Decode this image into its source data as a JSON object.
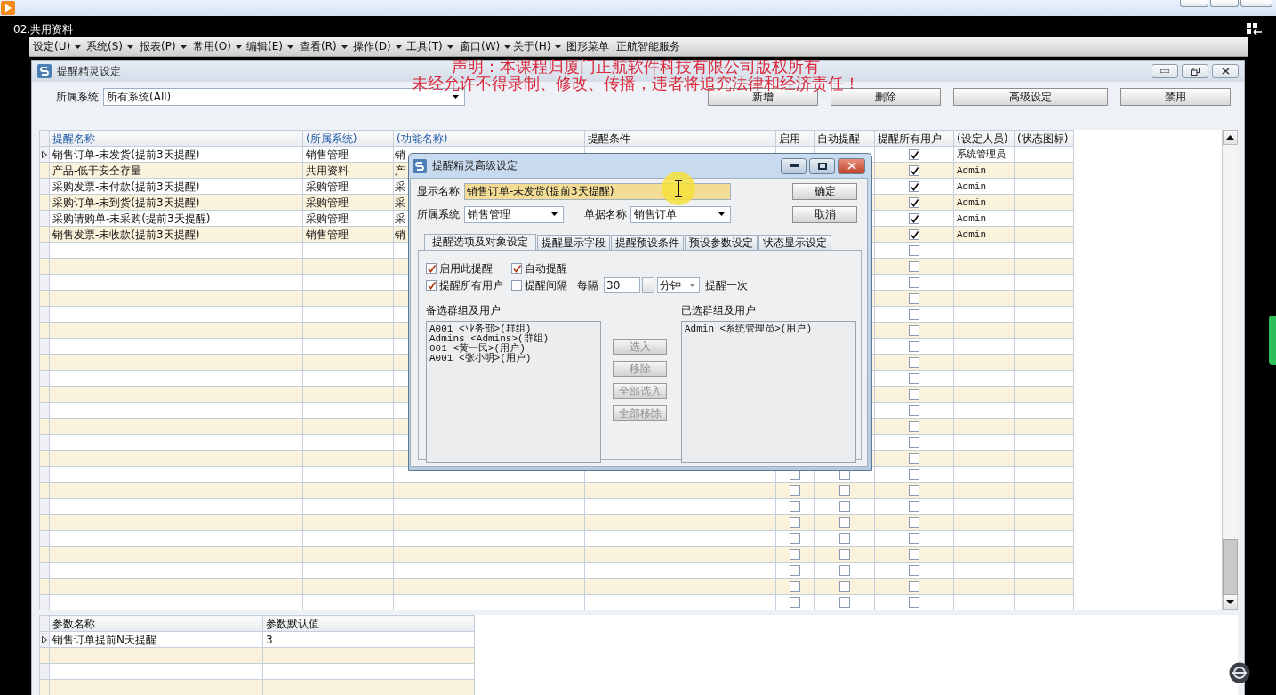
{
  "player": {
    "title": "02.共用资料"
  },
  "menu": [
    {
      "label": "设定(U)",
      "dropdown": true
    },
    {
      "label": "系统(S)",
      "dropdown": true
    },
    {
      "label": "报表(P)",
      "dropdown": true
    },
    {
      "label": "常用(O)",
      "dropdown": true
    },
    {
      "label": "编辑(E)",
      "dropdown": true
    },
    {
      "label": "查看(R)",
      "dropdown": true
    },
    {
      "label": "操作(D)",
      "dropdown": true
    },
    {
      "label": "工具(T)",
      "dropdown": true
    },
    {
      "label": "窗口(W)",
      "dropdown": true
    },
    {
      "label": "关于(H)",
      "dropdown": true
    },
    {
      "label": "图形菜单",
      "dropdown": false
    },
    {
      "label": "正航智能服务",
      "dropdown": false
    }
  ],
  "notice": [
    "声明：本课程归厦门正航软件科技有限公司版权所有",
    "未经允许不得录制、修改、传播，违者将追究法律和经济责任！"
  ],
  "window": {
    "title": "提醒精灵设定"
  },
  "filter": {
    "label": "所属系统",
    "value": "所有系统(All)"
  },
  "toolbar": [
    "新增",
    "删除",
    "高级设定",
    "禁用"
  ],
  "grid": {
    "columns": [
      {
        "label": "提醒名称",
        "highlighted": true
      },
      {
        "label": "(所属系统)",
        "highlighted": true
      },
      {
        "label": "(功能名称)",
        "highlighted": true
      },
      {
        "label": "提醒条件",
        "highlighted": false
      },
      {
        "label": "启用",
        "highlighted": false
      },
      {
        "label": "自动提醒",
        "highlighted": false
      },
      {
        "label": "提醒所有用户",
        "highlighted": false
      },
      {
        "label": "(设定人员)",
        "highlighted": false
      },
      {
        "label": "(状态图标)",
        "highlighted": false
      }
    ],
    "rows": [
      {
        "name": "销售订单-未发货(提前3天提醒)",
        "system": "销售管理",
        "function": "销",
        "all_users": true,
        "setter": "系统管理员",
        "selected": true
      },
      {
        "name": "产品-低于安全存量",
        "system": "共用资料",
        "function": "产",
        "all_users": true,
        "setter": "Admin",
        "selected": false
      },
      {
        "name": "采购发票-未付款(提前3天提醒)",
        "system": "采购管理",
        "function": "采",
        "all_users": true,
        "setter": "Admin",
        "selected": false
      },
      {
        "name": "采购订单-未到货(提前3天提醒)",
        "system": "采购管理",
        "function": "采",
        "all_users": true,
        "setter": "Admin",
        "selected": false
      },
      {
        "name": "采购请购单-未采购(提前3天提醒)",
        "system": "采购管理",
        "function": "采",
        "all_users": true,
        "setter": "Admin",
        "selected": false
      },
      {
        "name": "销售发票-未收款(提前3天提醒)",
        "system": "销售管理",
        "function": "销",
        "all_users": true,
        "setter": "Admin",
        "selected": false
      },
      {
        "all_users": false,
        "selected": false
      },
      {
        "all_users": false,
        "selected": false
      },
      {
        "all_users": false,
        "selected": false
      },
      {
        "all_users": false,
        "selected": false
      },
      {
        "all_users": false,
        "selected": false
      },
      {
        "all_users": false,
        "selected": false
      },
      {
        "all_users": false,
        "selected": false
      },
      {
        "all_users": false,
        "selected": false
      },
      {
        "all_users": false,
        "selected": false
      },
      {
        "all_users": false,
        "selected": false
      },
      {
        "all_users": false,
        "selected": false
      },
      {
        "all_users": false,
        "selected": false
      },
      {
        "all_users": false,
        "selected": false
      },
      {
        "all_users": false,
        "selected": false
      },
      {
        "enabled": false,
        "auto": false,
        "all_users": false,
        "selected": false
      },
      {
        "enabled": false,
        "auto": false,
        "all_users": false,
        "selected": false
      },
      {
        "enabled": false,
        "auto": false,
        "all_users": false,
        "selected": false
      },
      {
        "enabled": false,
        "auto": false,
        "all_users": false,
        "selected": false
      },
      {
        "enabled": false,
        "auto": false,
        "all_users": false,
        "selected": false
      },
      {
        "enabled": false,
        "auto": false,
        "all_users": false,
        "selected": false
      },
      {
        "enabled": false,
        "auto": false,
        "all_users": false,
        "selected": false
      },
      {
        "enabled": false,
        "auto": false,
        "all_users": false,
        "selected": false
      },
      {
        "enabled": false,
        "auto": false,
        "all_users": false,
        "selected": false
      }
    ]
  },
  "params": {
    "columns": [
      "参数名称",
      "参数默认值"
    ],
    "rows": [
      {
        "name": "销售订单提前N天提醒",
        "value": "3",
        "selected": true
      },
      {
        "selected": false
      },
      {
        "selected": false
      },
      {
        "selected": false
      }
    ]
  },
  "dialog": {
    "title": "提醒精灵高级设定",
    "display_name": {
      "label": "显示名称",
      "value": "销售订单-未发货(提前3天提醒)"
    },
    "system": {
      "label": "所属系统",
      "value": "销售管理"
    },
    "document": {
      "label": "单据名称",
      "value": "销售订单"
    },
    "buttons": [
      "确定",
      "取消"
    ],
    "tabs": [
      {
        "label": "提醒选项及对象设定",
        "selected": true
      },
      {
        "label": "提醒显示字段",
        "selected": false
      },
      {
        "label": "提醒预设条件",
        "selected": false
      },
      {
        "label": "预设参数设定",
        "selected": false
      },
      {
        "label": "状态显示设定",
        "selected": false
      }
    ],
    "options": [
      {
        "label": "启用此提醒",
        "checked": true
      },
      {
        "label": "自动提醒",
        "checked": true
      },
      {
        "label": "提醒所有用户",
        "checked": true
      },
      {
        "label": "提醒间隔",
        "checked": false
      }
    ],
    "interval": {
      "label": "每隔",
      "value": "30",
      "unit": "分钟",
      "suffix": "提醒一次"
    },
    "available": {
      "label": "备选群组及用户",
      "items": [
        "A001 <业务部>(群组)",
        "Admins <Admins>(群组)",
        "001 <黄一民>(用户)",
        "A001 <张小明>(用户)"
      ]
    },
    "chosen": {
      "label": "已选群组及用户",
      "items": [
        "Admin <系统管理员>(用户)"
      ]
    },
    "transfer_buttons": [
      {
        "label": "选入",
        "disabled": true
      },
      {
        "label": "移除",
        "disabled": true
      },
      {
        "label": "全部选入",
        "disabled": true
      },
      {
        "label": "全部移除",
        "disabled": true
      }
    ]
  }
}
